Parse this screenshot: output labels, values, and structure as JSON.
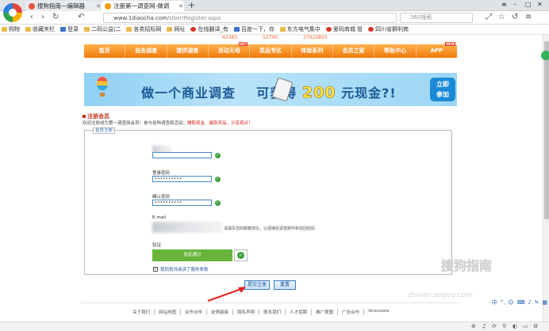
{
  "browser": {
    "tabs": [
      {
        "title": "搜狗指南—编辑器",
        "favicon_color": "#e5533c"
      },
      {
        "title": "注册第一调查网-做调",
        "favicon_color": "#f39c12"
      }
    ],
    "new_tab": "+",
    "window_controls": [
      "≡",
      "–",
      "□",
      "✕"
    ],
    "nav_buttons": [
      "‹",
      "›",
      "↻",
      "↶"
    ],
    "address_domain": "www.1diaocha.com",
    "address_path": "/User/Register.aspx",
    "search_placeholder": "360搜索",
    "toolbar_icons": [
      "⤢",
      "☆",
      "↺",
      "≡"
    ]
  },
  "bookmarks": [
    "购物",
    "收藏夹栏",
    "登录",
    "二码公益|二",
    "各类招标网",
    "网址",
    "在线翻译_有",
    "百度一下，你",
    "东方电气集中",
    "爱码商城",
    "管",
    "四川省群利商"
  ],
  "site": {
    "stats": [
      "42383",
      "52700",
      "27022855"
    ],
    "nav": [
      {
        "label": "首页",
        "hot": ""
      },
      {
        "label": "自由调查",
        "hot": ""
      },
      {
        "label": "提供调查",
        "hot": ""
      },
      {
        "label": "活动天地",
        "hot": "HOT"
      },
      {
        "label": "奖品专区",
        "hot": ""
      },
      {
        "label": "体验系列",
        "hot": ""
      },
      {
        "label": "会员之家",
        "hot": ""
      },
      {
        "label": "帮助中心",
        "hot": ""
      },
      {
        "label": "APP",
        "hot": "NEW"
      }
    ],
    "banner": {
      "text_a": "做一个商业调查",
      "text_b": "可获得",
      "amount": "200",
      "text_c": "元现金?!",
      "cta_line1": "立即",
      "cta_line2": "参加"
    },
    "heading": "注册会员",
    "intro_prefix": "欢迎注册成为第一调查网会员！参与各种调查和活动，",
    "intro_highlight": "赚取现金、赢取奖品、分享观点",
    "intro_suffix": "！",
    "form": {
      "legend": "会员注册",
      "username_value": "",
      "password_label": "登录密码",
      "password_value": "••••••••••",
      "confirm_label": "确认密码",
      "confirm_value": "••••••••••",
      "email_label": "E-mail",
      "email_hint": "请填写您的邮箱地址，以便接收调查邮件和找回密码",
      "verify_label": "验证",
      "verify_status": "验证通过",
      "ok_mark": "✓",
      "agree_label": "我同意并阅读了服务条款",
      "agree_checked": "✓",
      "submit_label": "提交注册",
      "reset_label": "重置"
    },
    "footer_links": [
      "关于我们",
      "网站地图",
      "合作伙伴",
      "友情链接",
      "隐私声明",
      "联系我们",
      "人才招聘",
      "推广联盟",
      "广告合作",
      "ibrandata"
    ]
  },
  "overlay": {
    "watermark": "搜狗指南",
    "watermark_sub": "zhinan.sogou.com",
    "ime_icons": [
      "中",
      "°,",
      "☺",
      "⌨",
      "♪",
      "✎",
      "▦"
    ]
  },
  "statusbar_icons": [
    "⊕",
    "♫",
    "⟳",
    "⚲",
    "◐",
    "▭",
    "⚙"
  ],
  "colors": {
    "accent_orange": "#f07a0c",
    "heading_red": "#c1331a",
    "verify_green": "#66b53a",
    "button_blue": "#3d7cc2"
  }
}
